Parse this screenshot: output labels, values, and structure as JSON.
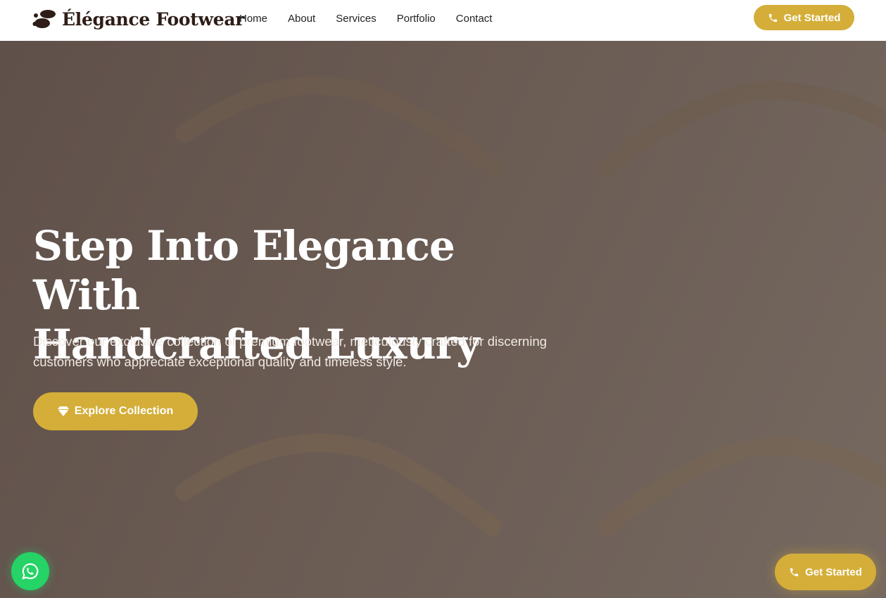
{
  "brand": {
    "name": "Élégance Footwear",
    "icon": "footprints-icon"
  },
  "nav": {
    "links": [
      "Home",
      "About",
      "Services",
      "Portfolio",
      "Contact"
    ],
    "cta_label": "Get Started",
    "cta_icon": "phone-icon"
  },
  "hero": {
    "title_line1": "Step Into Elegance With",
    "title_line2": "Handcrafted Luxury",
    "description": "Discover our exclusive collection of premium footwear, meticulously crafted for discerning customers who appreciate exceptional quality and timeless style.",
    "cta_label": "Explore Collection",
    "cta_icon": "gem-icon"
  },
  "floating": {
    "whatsapp_icon": "whatsapp-icon",
    "cta_label": "Get Started",
    "cta_icon": "phone-icon"
  },
  "colors": {
    "accent": "#d4ae39",
    "brand_text": "#2e1d16",
    "hero_bg": "#6a5b53",
    "whatsapp": "#25d366"
  }
}
